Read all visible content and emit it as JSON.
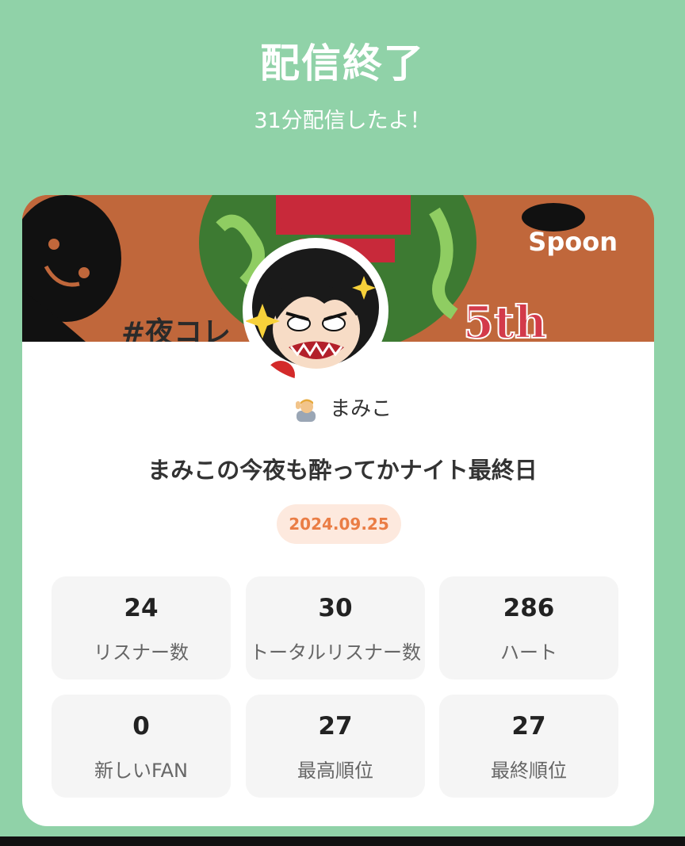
{
  "header": {
    "title": "配信終了",
    "subtitle": "31分配信したよ！"
  },
  "banner": {
    "logo": "Spoon",
    "hashtag_fragment": "#夜コレ",
    "badge_fragment": "5th",
    "background_color": "#c0673b"
  },
  "host": {
    "icon": "person-emoji-icon",
    "name": "まみこ"
  },
  "live": {
    "title": "まみこの今夜も酔ってかナイト最終日",
    "date": "2024.09.25"
  },
  "stats": [
    {
      "value": "24",
      "label": "リスナー数"
    },
    {
      "value": "30",
      "label": "トータルリスナー数"
    },
    {
      "value": "286",
      "label": "ハート"
    },
    {
      "value": "0",
      "label": "新しいFAN"
    },
    {
      "value": "27",
      "label": "最高順位"
    },
    {
      "value": "27",
      "label": "最終順位"
    }
  ],
  "colors": {
    "background": "#90d2a8",
    "accent": "#ea7d45",
    "date_badge_bg": "#fde9de"
  }
}
